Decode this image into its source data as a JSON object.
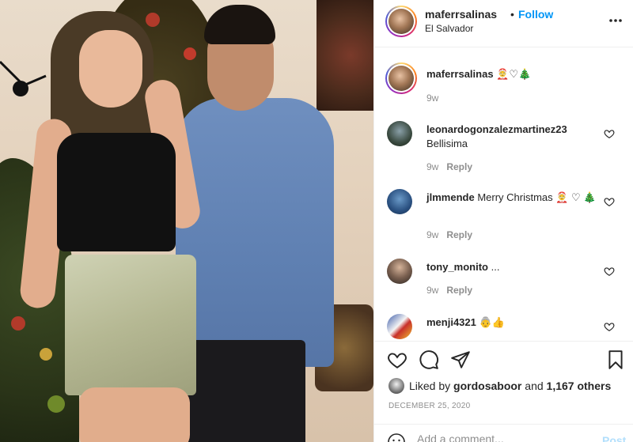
{
  "post": {
    "username": "maferrsalinas",
    "separator": "•",
    "follow_label": "Follow",
    "location": "El Salvador",
    "more_icon": "more-horizontal-icon"
  },
  "caption": {
    "username": "maferrsalinas",
    "text": "🤶♡🎄",
    "time": "9w"
  },
  "comments": [
    {
      "username": "leonardogonzalezmartinez23",
      "text": "Bellisima",
      "time": "9w",
      "reply_label": "Reply"
    },
    {
      "username": "jlmmende",
      "text": "Merry Christmas 🤶 ♡ 🎄",
      "time": "9w",
      "reply_label": "Reply"
    },
    {
      "username": "tony_monito",
      "text": "...",
      "time": "9w",
      "reply_label": "Reply"
    },
    {
      "username": "menji4321",
      "text": "👵👍",
      "time": "",
      "reply_label": ""
    }
  ],
  "actions": {
    "like_icon": "heart-icon",
    "comment_icon": "comment-icon",
    "share_icon": "paper-plane-icon",
    "save_icon": "bookmark-icon"
  },
  "likes": {
    "prefix": "Liked by",
    "user": "gordosaboor",
    "and": "and",
    "others": "1,167 others"
  },
  "date": "DECEMBER 25, 2020",
  "add_comment": {
    "placeholder": "Add a comment...",
    "post_label": "Post"
  },
  "colors": {
    "follow": "#0095f6",
    "muted": "#8e8e8e",
    "post_disabled": "#b2dffc"
  }
}
